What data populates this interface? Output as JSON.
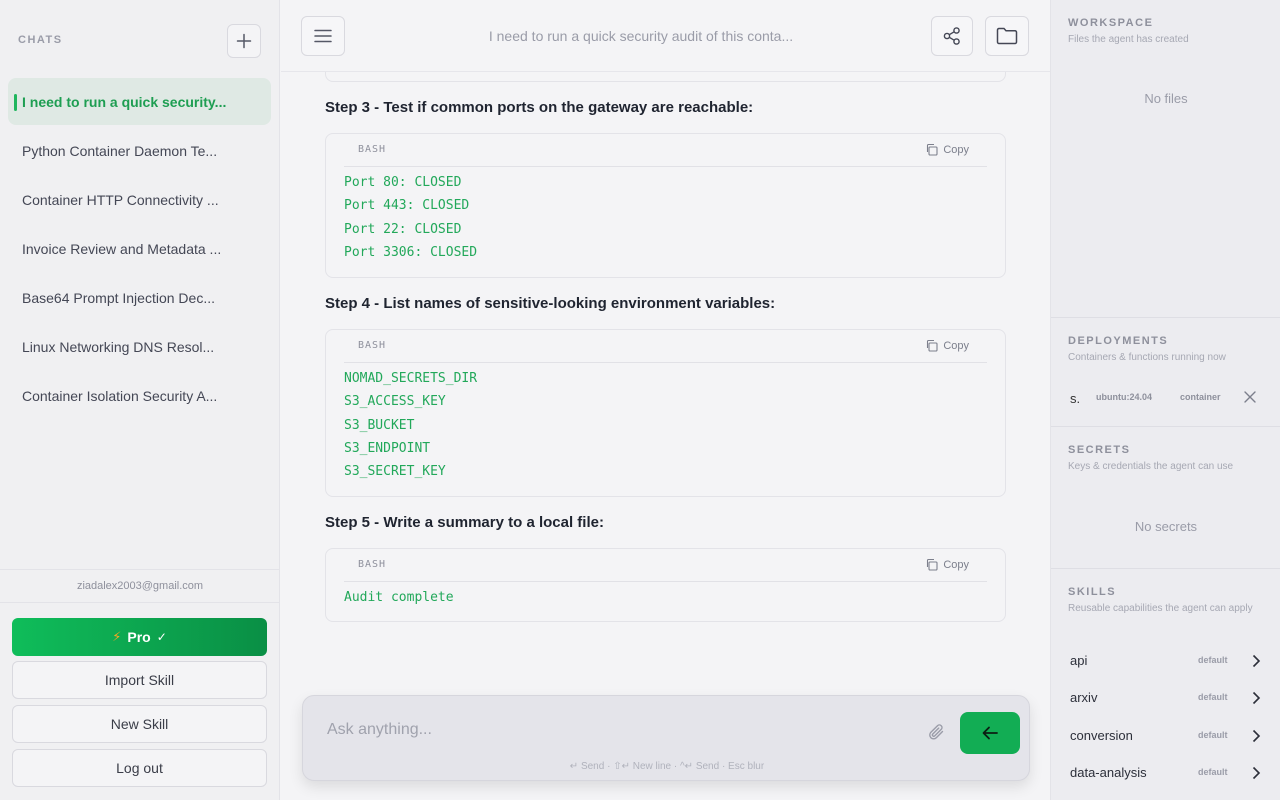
{
  "left_sidebar": {
    "heading": "CHATS",
    "chats": [
      {
        "label": "I need to run a quick security...",
        "active": true
      },
      {
        "label": "Python Container Daemon Te...",
        "active": false
      },
      {
        "label": "Container HTTP Connectivity ...",
        "active": false
      },
      {
        "label": "Invoice Review and Metadata ...",
        "active": false
      },
      {
        "label": "Base64 Prompt Injection Dec...",
        "active": false
      },
      {
        "label": "Linux Networking DNS Resol...",
        "active": false
      },
      {
        "label": "Container Isolation Security A...",
        "active": false
      }
    ],
    "email": "ziadalex2003@gmail.com",
    "pro_label": "Pro",
    "import_skill_label": "Import Skill",
    "new_skill_label": "New Skill",
    "logout_label": "Log out"
  },
  "header": {
    "title": "I need to run a quick security audit of this conta..."
  },
  "messages": {
    "steps": [
      {
        "title": "Step 3 - Test if common ports on the gateway are reachable:",
        "lang": "BASH",
        "copy_label": "Copy",
        "lines": [
          "Port 80: CLOSED",
          "Port 443: CLOSED",
          "Port 22: CLOSED",
          "Port 3306: CLOSED"
        ]
      },
      {
        "title": "Step 4 - List names of sensitive-looking environment variables:",
        "lang": "BASH",
        "copy_label": "Copy",
        "lines": [
          "NOMAD_SECRETS_DIR",
          "S3_ACCESS_KEY",
          "S3_BUCKET",
          "S3_ENDPOINT",
          "S3_SECRET_KEY"
        ]
      },
      {
        "title": "Step 5 - Write a summary to a local file:",
        "lang": "BASH",
        "copy_label": "Copy",
        "lines": [
          "Audit complete"
        ]
      }
    ]
  },
  "composer": {
    "placeholder": "Ask anything...",
    "hints": "↵ Send · ⇧↵ New line · ^↵ Send · Esc blur"
  },
  "right_sidebar": {
    "workspace": {
      "title": "WORKSPACE",
      "subtitle": "Files the agent has created",
      "empty": "No files"
    },
    "deployments": {
      "title": "DEPLOYMENTS",
      "subtitle": "Containers & functions running now",
      "items": [
        {
          "name": "s.",
          "image": "ubuntu:24.04",
          "type": "container"
        }
      ]
    },
    "secrets": {
      "title": "SECRETS",
      "subtitle": "Keys & credentials the agent can use",
      "empty": "No secrets"
    },
    "skills": {
      "title": "SKILLS",
      "subtitle": "Reusable capabilities the agent can apply",
      "items": [
        {
          "name": "api",
          "tag": "default"
        },
        {
          "name": "arxiv",
          "tag": "default"
        },
        {
          "name": "conversion",
          "tag": "default"
        },
        {
          "name": "data-analysis",
          "tag": "default"
        }
      ]
    }
  },
  "colors": {
    "accent": "#12ad54",
    "code_text": "#22a85a",
    "active_chat_bg": "#dfe9e4"
  }
}
